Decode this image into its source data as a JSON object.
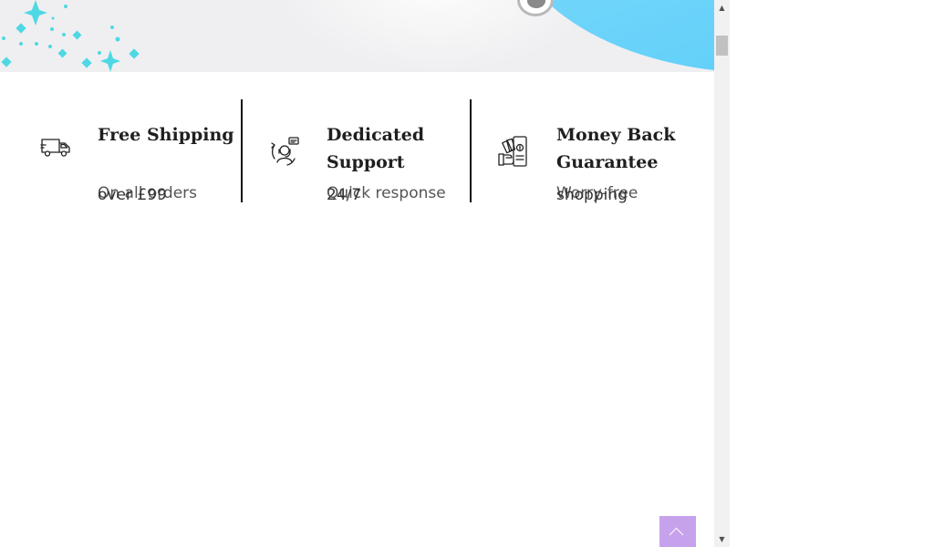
{
  "features": [
    {
      "icon": "delivery-truck-icon",
      "title": "Free Shipping",
      "subtitle_primary": "On all orders",
      "subtitle_secondary": "over £99"
    },
    {
      "icon": "customer-support-icon",
      "title": "Dedicated Support",
      "subtitle_primary": "Quick response",
      "subtitle_secondary": "24/7"
    },
    {
      "icon": "money-back-icon",
      "title": "Money Back Guarantee",
      "subtitle_primary": "Worry-free",
      "subtitle_secondary": "shopping"
    }
  ],
  "back_to_top": {
    "icon": "chevron-up-icon"
  },
  "scrollbar": {
    "up_arrow": "▲",
    "down_arrow": "▼"
  },
  "colors": {
    "hero_background": "#efeff1",
    "hero_accent": "#6ad3fa",
    "sparkle": "#4fd8e3",
    "back_to_top": "#c7a2ec",
    "divider": "#111111"
  }
}
